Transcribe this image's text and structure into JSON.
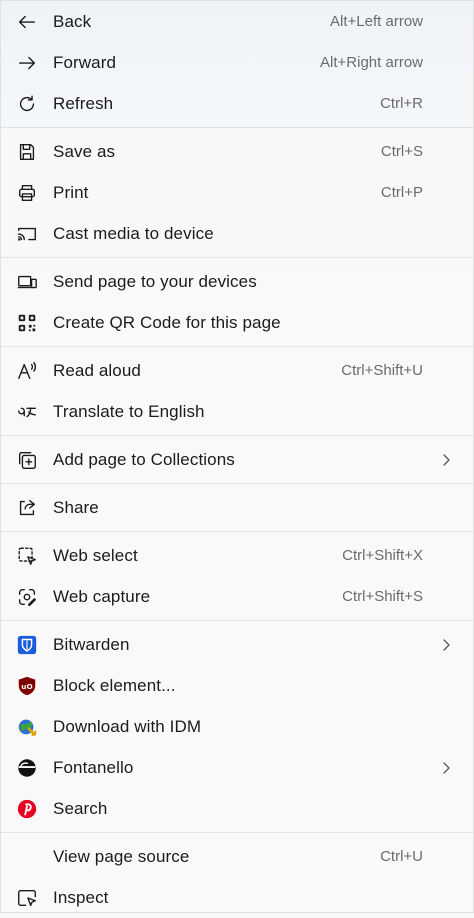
{
  "menu": {
    "back": {
      "label": "Back",
      "shortcut": "Alt+Left arrow"
    },
    "forward": {
      "label": "Forward",
      "shortcut": "Alt+Right arrow"
    },
    "refresh": {
      "label": "Refresh",
      "shortcut": "Ctrl+R"
    },
    "save_as": {
      "label": "Save as",
      "shortcut": "Ctrl+S"
    },
    "print": {
      "label": "Print",
      "shortcut": "Ctrl+P"
    },
    "cast": {
      "label": "Cast media to device"
    },
    "send_page": {
      "label": "Send page to your devices"
    },
    "qr_code": {
      "label": "Create QR Code for this page"
    },
    "read_aloud": {
      "label": "Read aloud",
      "shortcut": "Ctrl+Shift+U"
    },
    "translate": {
      "label": "Translate to English"
    },
    "collections": {
      "label": "Add page to Collections"
    },
    "share": {
      "label": "Share"
    },
    "web_select": {
      "label": "Web select",
      "shortcut": "Ctrl+Shift+X"
    },
    "web_capture": {
      "label": "Web capture",
      "shortcut": "Ctrl+Shift+S"
    },
    "bitwarden": {
      "label": "Bitwarden"
    },
    "block_element": {
      "label": "Block element..."
    },
    "idm": {
      "label": "Download with IDM"
    },
    "fontanello": {
      "label": "Fontanello"
    },
    "pinterest_search": {
      "label": "Search"
    },
    "view_source": {
      "label": "View page source",
      "shortcut": "Ctrl+U"
    },
    "inspect": {
      "label": "Inspect"
    }
  },
  "colors": {
    "bitwarden": "#175ddc",
    "ublock": "#800000",
    "pinterest": "#e60023",
    "idm_green": "#3aa635",
    "idm_blue": "#2f6fd0"
  }
}
